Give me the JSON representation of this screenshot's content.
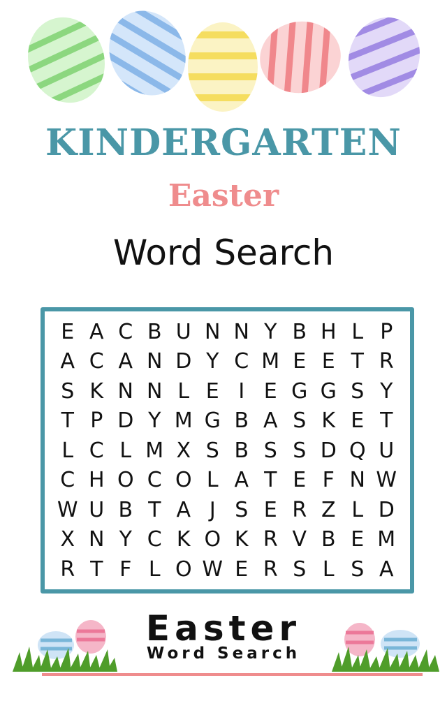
{
  "header": {
    "line1": "KINDERGARTEN",
    "line2": "Easter",
    "line3": "Word Search"
  },
  "eggs": [
    {
      "name": "green-egg-icon",
      "color": "#8fdc86"
    },
    {
      "name": "blue-egg-icon",
      "color": "#8ab8ea"
    },
    {
      "name": "yellow-egg-icon",
      "color": "#f7e06a"
    },
    {
      "name": "red-egg-icon",
      "color": "#f18b8f"
    },
    {
      "name": "purple-egg-icon",
      "color": "#a58ee6"
    }
  ],
  "puzzle": {
    "rows": [
      [
        "E",
        "A",
        "C",
        "B",
        "U",
        "N",
        "N",
        "Y",
        "B",
        "H",
        "L",
        "P"
      ],
      [
        "A",
        "C",
        "A",
        "N",
        "D",
        "Y",
        "C",
        "M",
        "E",
        "E",
        "T",
        "R"
      ],
      [
        "S",
        "K",
        "N",
        "N",
        "L",
        "E",
        "I",
        "E",
        "G",
        "G",
        "S",
        "Y"
      ],
      [
        "T",
        "P",
        "D",
        "Y",
        "M",
        "G",
        "B",
        "A",
        "S",
        "K",
        "E",
        "T"
      ],
      [
        "L",
        "C",
        "L",
        "M",
        "X",
        "S",
        "B",
        "S",
        "S",
        "D",
        "Q",
        "U"
      ],
      [
        "C",
        "H",
        "O",
        "C",
        "O",
        "L",
        "A",
        "T",
        "E",
        "F",
        "N",
        "W"
      ],
      [
        "W",
        "U",
        "B",
        "T",
        "A",
        "J",
        "S",
        "E",
        "R",
        "Z",
        "L",
        "D"
      ],
      [
        "X",
        "N",
        "Y",
        "C",
        "K",
        "O",
        "K",
        "R",
        "V",
        "B",
        "E",
        "M"
      ],
      [
        "R",
        "T",
        "F",
        "L",
        "O",
        "W",
        "E",
        "R",
        "S",
        "L",
        "S",
        "A"
      ]
    ]
  },
  "footer": {
    "title": "Easter",
    "subtitle": "Word Search"
  },
  "colors": {
    "teal": "#4a97a7",
    "pink": "#ef8c8d",
    "text": "#111111"
  }
}
